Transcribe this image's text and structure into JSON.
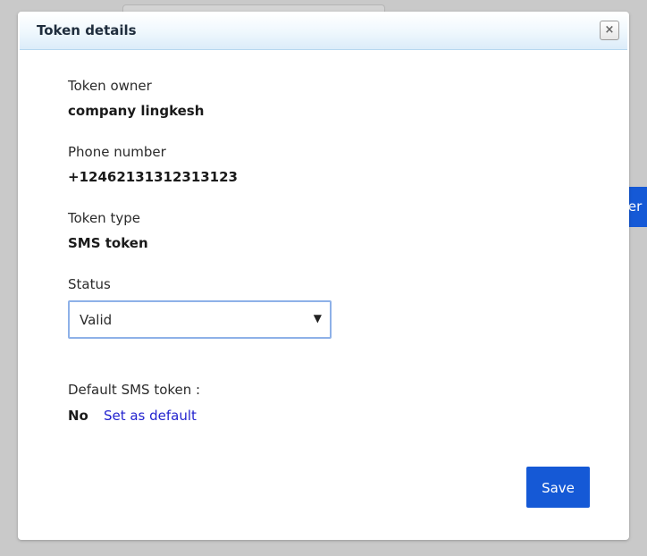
{
  "background": {
    "side_button_label": "ter"
  },
  "dialog": {
    "title": "Token details",
    "close_label": "×",
    "fields": {
      "owner": {
        "label": "Token owner",
        "value": "company lingkesh"
      },
      "phone": {
        "label": "Phone number",
        "value": "+12462131312313123"
      },
      "type": {
        "label": "Token type",
        "value": "SMS token"
      }
    },
    "status": {
      "label": "Status",
      "selected": "Valid",
      "arrow": "▼"
    },
    "default_sms": {
      "label": "Default SMS token :",
      "value": "No",
      "link_label": "Set as default"
    },
    "save_label": "Save"
  },
  "colors": {
    "primary_button": "#1559d6",
    "link": "#2323cf",
    "select_border": "#8eb1e8",
    "header_gradient_end": "#dcecf9"
  }
}
